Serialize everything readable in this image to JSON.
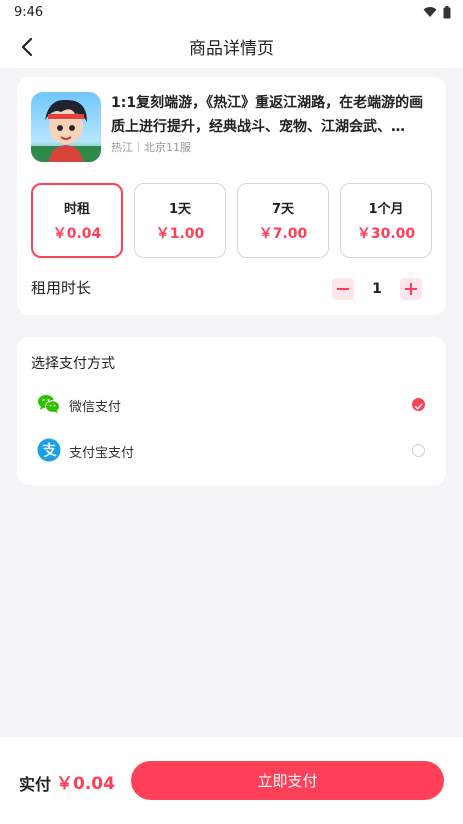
{
  "status_bar": {
    "time": "9:46"
  },
  "nav": {
    "title": "商品详情页"
  },
  "product": {
    "title": "1:1复刻端游，《热江》重返江湖路，在老端游的画质上进行提升，经典战斗、宠物、江湖会武、…",
    "game": "热江",
    "server": "北京11服"
  },
  "plans": [
    {
      "name": "时租",
      "price": "￥0.04",
      "selected": true
    },
    {
      "name": "1天",
      "price": "￥1.00",
      "selected": false
    },
    {
      "name": "7天",
      "price": "￥7.00",
      "selected": false
    },
    {
      "name": "1个月",
      "price": "￥30.00",
      "selected": false
    }
  ],
  "duration": {
    "label": "租用时长",
    "value": "1"
  },
  "payment": {
    "heading": "选择支付方式",
    "options": [
      {
        "label": "微信支付",
        "icon": "wechat-pay-icon",
        "checked": true
      },
      {
        "label": "支付宝支付",
        "icon": "alipay-icon",
        "checked": false
      }
    ]
  },
  "checkout": {
    "total_label": "实付",
    "total_amount": "￥0.04",
    "button_label": "立即支付"
  },
  "colors": {
    "accent": "#ff4058",
    "background": "#f5f5f7",
    "wechat_green": "#2dc100",
    "alipay_blue": "#1aa0e8"
  }
}
